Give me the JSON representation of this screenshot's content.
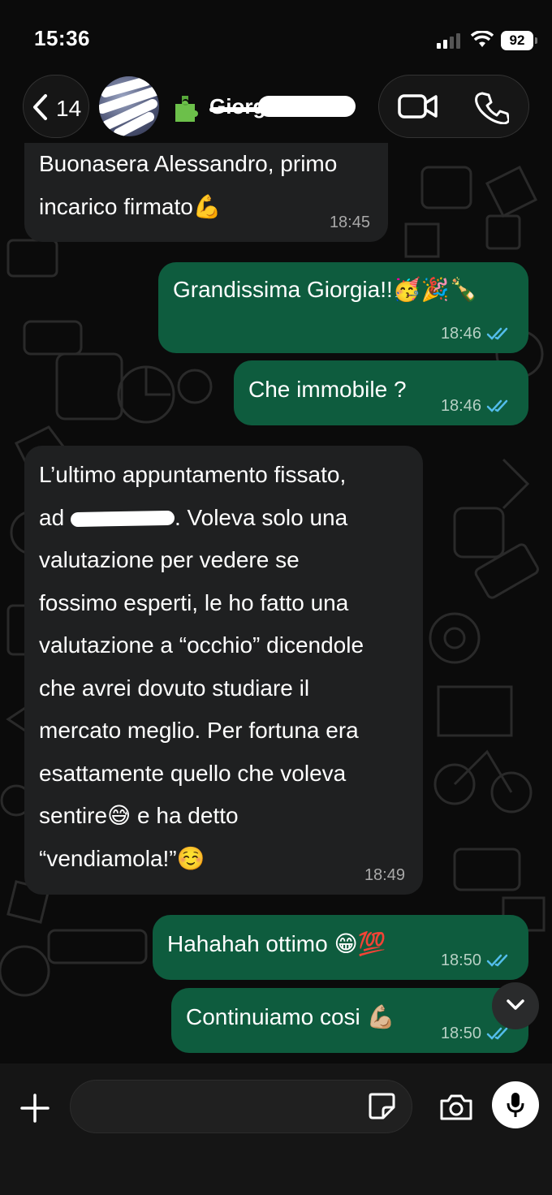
{
  "status_bar": {
    "time": "15:36",
    "battery": "92"
  },
  "header": {
    "back_count": "14",
    "contact_name": "Giorgia"
  },
  "messages": [
    {
      "direction": "in",
      "lines": [
        "Buonasera Alessandro, primo",
        "incarico firmato"
      ],
      "emoji": "💪",
      "time": "18:45"
    },
    {
      "direction": "out",
      "text": "Grandissima Giorgia!!",
      "emoji": "🥳🎉🍾",
      "time": "18:46",
      "read": true
    },
    {
      "direction": "out",
      "text": "Che immobile ?",
      "time": "18:46",
      "read": true
    },
    {
      "direction": "in",
      "lines": [
        "L’ultimo appuntamento fissato,",
        "ad",
        ". Voleva solo una",
        "valutazione per vedere se",
        "fossimo esperti, le ho fatto una",
        "valutazione a “occhio” dicendole",
        "che avrei dovuto studiare il",
        "mercato meglio. Per fortuna era",
        "esattamente quello che voleva",
        "sentire",
        " e ha detto",
        "“vendiamola!”"
      ],
      "emojis": [
        "😅",
        "☺️"
      ],
      "time": "18:49"
    },
    {
      "direction": "out",
      "text": "Hahahah ottimo",
      "emoji": "😁💯",
      "time": "18:50",
      "read": true
    },
    {
      "direction": "out",
      "text": "Continuiamo cosi",
      "emoji": "💪🏼",
      "time": "18:50",
      "read": true
    }
  ],
  "colors": {
    "incoming": "#1f2021",
    "outgoing": "#0e5c3e",
    "read_ticks": "#53bdeb",
    "background": "#0b0b0b"
  },
  "icons": [
    "back-chevron-icon",
    "puzzle-icon",
    "video-call-icon",
    "phone-icon",
    "chevron-down-icon",
    "plus-icon",
    "sticker-icon",
    "camera-icon",
    "mic-icon"
  ]
}
